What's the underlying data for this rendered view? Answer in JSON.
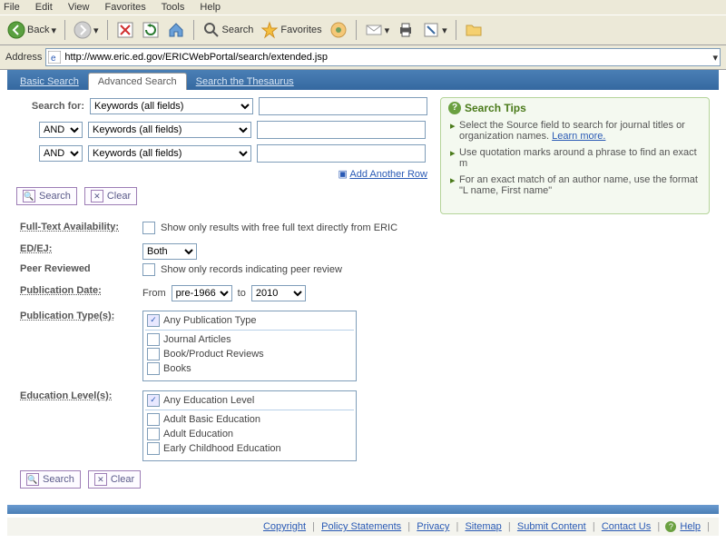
{
  "menubar": [
    "File",
    "Edit",
    "View",
    "Favorites",
    "Tools",
    "Help"
  ],
  "toolbar": {
    "back": "Back",
    "search": "Search",
    "favorites": "Favorites"
  },
  "address_label": "Address",
  "url": "http://www.eric.ed.gov/ERICWebPortal/search/extended.jsp",
  "tabs": {
    "basic": "Basic Search",
    "advanced": "Advanced Search",
    "thesaurus": "Search the Thesaurus"
  },
  "form": {
    "search_for": "Search for:",
    "field_options": [
      "Keywords (all fields)"
    ],
    "op_options": [
      "AND"
    ],
    "add_row": "Add Another Row",
    "btn_search": "Search",
    "btn_clear": "Clear"
  },
  "tips": {
    "heading": "Search Tips",
    "items": [
      "Select the Source field to search for journal titles or organization names.",
      "Use quotation marks around a phrase to find an exact m",
      "For an exact match of an author name, use the format \"L name, First name\""
    ],
    "learn_more": "Learn more."
  },
  "filters": {
    "fulltext_lbl": "Full-Text Availability:",
    "fulltext_txt": "Show only results with free full text directly from ERIC",
    "edej_lbl": "ED/EJ:",
    "edej_val": "Both",
    "peer_lbl": "Peer Reviewed",
    "peer_txt": "Show only records indicating peer review",
    "pubdate_lbl": "Publication Date:",
    "pubdate_from": "From",
    "pubdate_to": "to",
    "year_from": "pre-1966",
    "year_to": "2010",
    "pubtype_lbl": "Publication Type(s):",
    "pubtype_items": [
      "Any Publication Type",
      "Journal Articles",
      "Book/Product Reviews",
      "Books"
    ],
    "edulevel_lbl": "Education Level(s):",
    "edulevel_items": [
      "Any Education Level",
      "Adult Basic Education",
      "Adult Education",
      "Early Childhood Education"
    ]
  },
  "footer": {
    "links": [
      "Copyright",
      "Policy Statements",
      "Privacy",
      "Sitemap",
      "Submit Content",
      "Contact Us"
    ],
    "help": "Help"
  }
}
